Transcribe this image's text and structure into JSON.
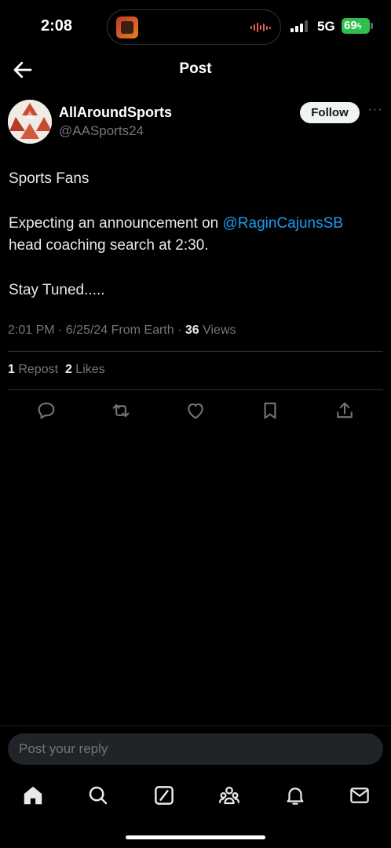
{
  "status_bar": {
    "time": "2:08",
    "network": "5G",
    "battery": "69"
  },
  "header": {
    "title": "Post",
    "back_icon": "arrow-left-icon"
  },
  "post": {
    "author": {
      "display_name": "AllAroundSports",
      "handle": "@AASports24"
    },
    "follow_label": "Follow",
    "more_icon": "more-horizontal-icon",
    "more_label": "···",
    "body": {
      "line1": "Sports Fans",
      "line2_prefix": "Expecting an announcement on ",
      "mention": "@RaginCajunsSB",
      "line3": "head coaching search at 2:30.",
      "line4": "Stay Tuned....."
    },
    "meta": {
      "timestamp": "2:01 PM · 6/25/24 From Earth · ",
      "views_count": "36",
      "views_label": " Views"
    },
    "stats": {
      "reposts_count": "1",
      "reposts_label": " Repost  ",
      "likes_count": "2",
      "likes_label": " Likes"
    },
    "actions": [
      "reply-icon",
      "repost-icon",
      "like-icon",
      "bookmark-icon",
      "share-icon"
    ]
  },
  "reply": {
    "placeholder": "Post your reply"
  },
  "bottom_nav": [
    "home-icon",
    "search-icon",
    "grok-icon",
    "communities-icon",
    "notifications-icon",
    "messages-icon"
  ],
  "colors": {
    "background": "#000000",
    "accent": "#1d9bf0",
    "secondary_text": "#71767b",
    "battery": "#2fbf4f"
  }
}
